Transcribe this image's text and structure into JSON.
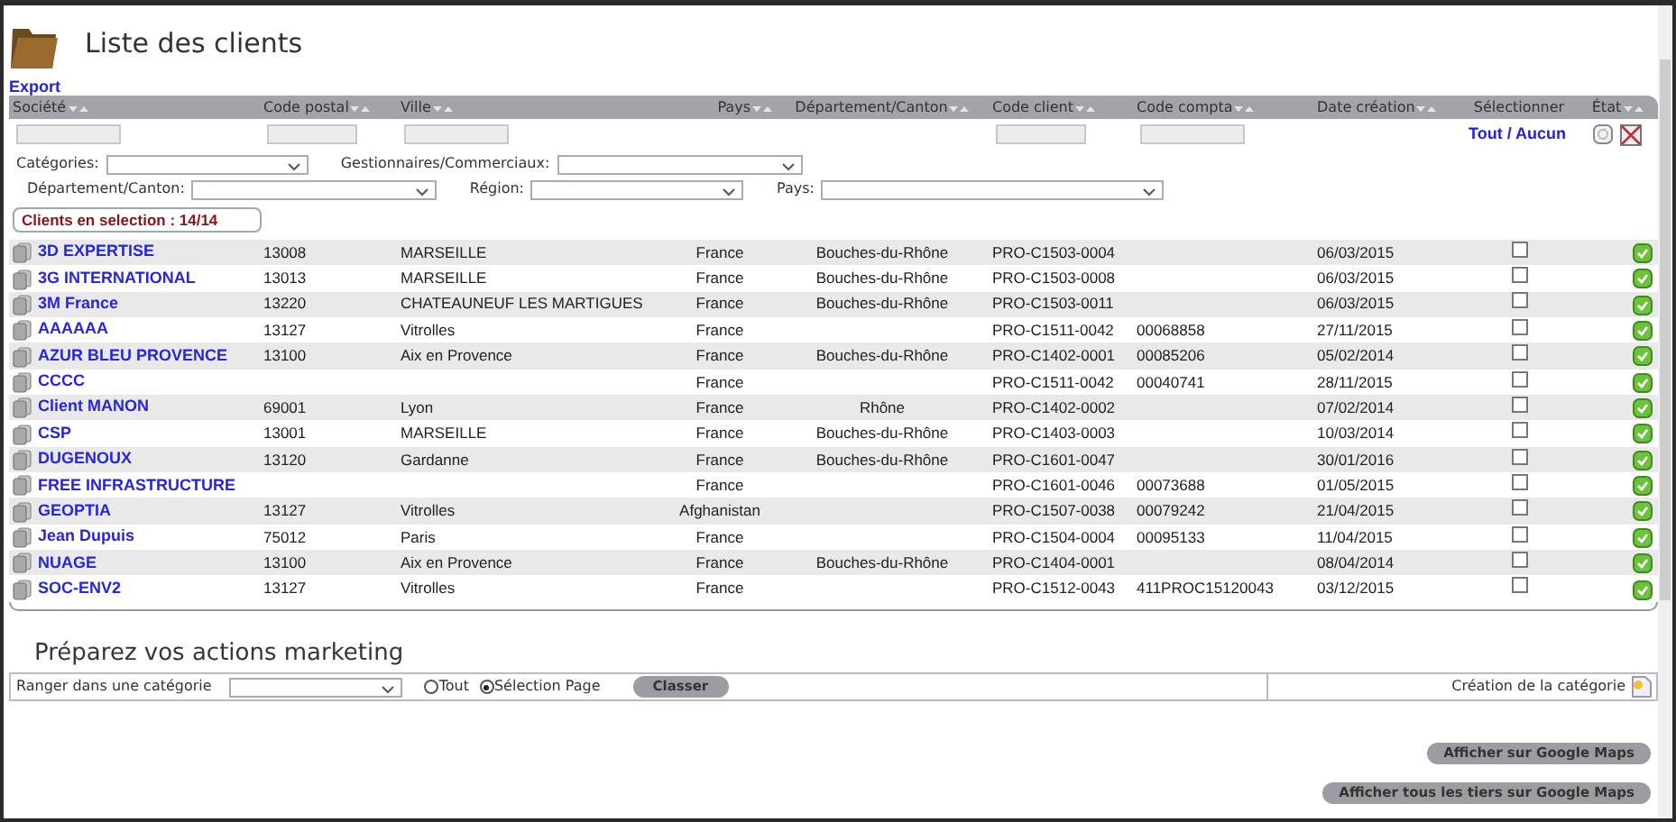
{
  "title": "Liste des clients",
  "export_link": "Export",
  "table": {
    "columns": [
      {
        "label": "Société",
        "sortable": true,
        "filter": true
      },
      {
        "label": "Code postal",
        "sortable": true,
        "filter": true
      },
      {
        "label": "Ville",
        "sortable": true,
        "filter": true
      },
      {
        "label": "Pays",
        "sortable": true,
        "filter": false
      },
      {
        "label": "Département/Canton",
        "sortable": true,
        "filter": false
      },
      {
        "label": "Code client",
        "sortable": true,
        "filter": true
      },
      {
        "label": "Code compta",
        "sortable": true,
        "filter": true
      },
      {
        "label": "Date création",
        "sortable": true,
        "filter": false
      },
      {
        "label": "Sélectionner",
        "sortable": false,
        "filter": false
      },
      {
        "label": "État",
        "sortable": true,
        "filter": false
      }
    ],
    "select_links": {
      "all": "Tout",
      "separator": "/",
      "none": "Aucun"
    },
    "rows": [
      {
        "company": "3D EXPERTISE",
        "postal_code": "13008",
        "city": "MARSEILLE",
        "country": "France",
        "department": "Bouches-du-Rhône",
        "client_code": "PRO-C1503-0004",
        "accounting_code": "",
        "created": "06/03/2015",
        "selected": false
      },
      {
        "company": "3G INTERNATIONAL",
        "postal_code": "13013",
        "city": "MARSEILLE",
        "country": "France",
        "department": "Bouches-du-Rhône",
        "client_code": "PRO-C1503-0008",
        "accounting_code": "",
        "created": "06/03/2015",
        "selected": false
      },
      {
        "company": "3M France",
        "postal_code": "13220",
        "city": "CHATEAUNEUF LES MARTIGUES",
        "country": "France",
        "department": "Bouches-du-Rhône",
        "client_code": "PRO-C1503-0011",
        "accounting_code": "",
        "created": "06/03/2015",
        "selected": false
      },
      {
        "company": "AAAAAA",
        "postal_code": "13127",
        "city": "Vitrolles",
        "country": "France",
        "department": "",
        "client_code": "PRO-C1511-0042",
        "accounting_code": "00068858",
        "created": "27/11/2015",
        "selected": false
      },
      {
        "company": "AZUR BLEU PROVENCE",
        "postal_code": "13100",
        "city": "Aix en Provence",
        "country": "France",
        "department": "Bouches-du-Rhône",
        "client_code": "PRO-C1402-0001",
        "accounting_code": "00085206",
        "created": "05/02/2014",
        "selected": false
      },
      {
        "company": "CCCC",
        "postal_code": "",
        "city": "",
        "country": "France",
        "department": "",
        "client_code": "PRO-C1511-0042",
        "accounting_code": "00040741",
        "created": "28/11/2015",
        "selected": false
      },
      {
        "company": "Client MANON",
        "postal_code": "69001",
        "city": "Lyon",
        "country": "France",
        "department": "Rhône",
        "client_code": "PRO-C1402-0002",
        "accounting_code": "",
        "created": "07/02/2014",
        "selected": false
      },
      {
        "company": "CSP",
        "postal_code": "13001",
        "city": "MARSEILLE",
        "country": "France",
        "department": "Bouches-du-Rhône",
        "client_code": "PRO-C1403-0003",
        "accounting_code": "",
        "created": "10/03/2014",
        "selected": false
      },
      {
        "company": "DUGENOUX",
        "postal_code": "13120",
        "city": "Gardanne",
        "country": "France",
        "department": "Bouches-du-Rhône",
        "client_code": "PRO-C1601-0047",
        "accounting_code": "",
        "created": "30/01/2016",
        "selected": false
      },
      {
        "company": "FREE INFRASTRUCTURE",
        "postal_code": "",
        "city": "",
        "country": "France",
        "department": "",
        "client_code": "PRO-C1601-0046",
        "accounting_code": "00073688",
        "created": "01/05/2015",
        "selected": false
      },
      {
        "company": "GEOPTIA",
        "postal_code": "13127",
        "city": "Vitrolles",
        "country": "Afghanistan",
        "department": "",
        "client_code": "PRO-C1507-0038",
        "accounting_code": "00079242",
        "created": "21/04/2015",
        "selected": false
      },
      {
        "company": "Jean Dupuis",
        "postal_code": "75012",
        "city": "Paris",
        "country": "France",
        "department": "",
        "client_code": "PRO-C1504-0004",
        "accounting_code": "00095133",
        "created": "11/04/2015",
        "selected": false
      },
      {
        "company": "NUAGE",
        "postal_code": "13100",
        "city": "Aix en Provence",
        "country": "France",
        "department": "Bouches-du-Rhône",
        "client_code": "PRO-C1404-0001",
        "accounting_code": "",
        "created": "08/04/2014",
        "selected": false
      },
      {
        "company": "SOC-ENV2",
        "postal_code": "13127",
        "city": "Vitrolles",
        "country": "France",
        "department": "",
        "client_code": "PRO-C1512-0043",
        "accounting_code": "411PROC15120043",
        "created": "03/12/2015",
        "selected": false
      }
    ]
  },
  "filter_rows": [
    [
      {
        "label": "Catégories:"
      },
      {
        "label": "Gestionnaires/Commerciaux:"
      }
    ],
    [
      {
        "label": "Département/Canton:"
      },
      {
        "label": "Région:"
      },
      {
        "label": "Pays:"
      }
    ]
  ],
  "selection_count": "Clients en selection : 14/14",
  "marketing": {
    "title": "Préparez vos actions marketing",
    "label": "Ranger dans une catégorie",
    "radios": [
      {
        "label": "Tout",
        "selected": false
      },
      {
        "label": "Sélection Page",
        "selected": true
      }
    ],
    "button": "Classer",
    "create_link": "Création de la catégorie"
  },
  "buttons": [
    "Afficher sur Google Maps",
    "Afficher tous les tiers sur Google Maps"
  ]
}
